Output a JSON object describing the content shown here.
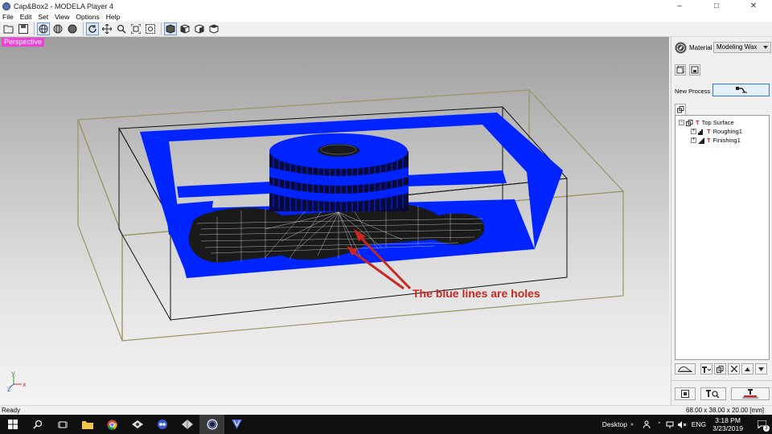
{
  "window": {
    "title": "Cap&Box2 - MODELA Player 4",
    "min_glyph": "–",
    "max_glyph": "□",
    "close_glyph": "✕"
  },
  "menu": [
    "File",
    "Edit",
    "Set",
    "View",
    "Options",
    "Help"
  ],
  "toolbar": {
    "buttons": [
      "open-icon",
      "save-icon",
      "wireframe-view-icon",
      "solid-view-icon",
      "shaded-view-icon",
      "rotate-icon",
      "pan-icon",
      "zoom-icon",
      "fit-icon",
      "zoom-box-icon",
      "perspective-icon",
      "front-view-icon",
      "side-view-icon",
      "top-view-icon"
    ]
  },
  "viewport": {
    "view_label": "Perspective",
    "annotation": "The blue lines are holes",
    "axes": {
      "x": "x",
      "y": "y",
      "z": "z"
    }
  },
  "panel": {
    "material_label": "Material",
    "material_value": "Modeling Wax",
    "new_process_label": "New Process",
    "tree": {
      "root": "Top Surface",
      "children": [
        "Roughing1",
        "Finishing1"
      ]
    }
  },
  "status": {
    "left": "Ready",
    "right": "68.00 x 38.00 x 20.00 [mm]"
  },
  "taskbar": {
    "desktop_label": "Desktop",
    "lang": "ENG",
    "time": "3:18 PM",
    "date": "3/23/2019",
    "notif_count": "3"
  },
  "colors": {
    "model_blue": "#0024ff",
    "annotation_red": "#c8281e",
    "perspective_tag": "#f040d8"
  }
}
